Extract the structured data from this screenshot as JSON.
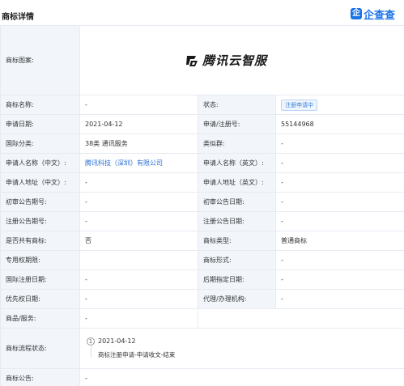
{
  "header": {
    "title": "商标详情",
    "brand_icon": "企",
    "brand_name": "企查查"
  },
  "logo": {
    "label": "商标图案:",
    "text": "腾讯云智服"
  },
  "rows": [
    {
      "l1": "商标名称:",
      "v1": "-",
      "l2": "状态:",
      "v2": "注册申请中"
    },
    {
      "l1": "申请日期:",
      "v1": "2021-04-12",
      "l2": "申请/注册号:",
      "v2": "55144968"
    },
    {
      "l1": "国际分类:",
      "v1": "38类 通讯服务",
      "l2": "类似群:",
      "v2": "-"
    },
    {
      "l1": "申请人名称（中文）:",
      "v1": "腾讯科技（深圳）有限公司",
      "l2": "申请人名称（英文）:",
      "v2": "-"
    },
    {
      "l1": "申请人地址（中文）:",
      "v1": "-",
      "l2": "申请人地址（英文）:",
      "v2": "-"
    },
    {
      "l1": "初审公告期号:",
      "v1": "-",
      "l2": "初审公告日期:",
      "v2": "-"
    },
    {
      "l1": "注册公告期号:",
      "v1": "-",
      "l2": "注册公告日期:",
      "v2": "-"
    },
    {
      "l1": "是否共有商标:",
      "v1": "否",
      "l2": "商标类型:",
      "v2": "普通商标"
    },
    {
      "l1": "专用权期限:",
      "v1": "",
      "l2": "商标形式:",
      "v2": "-"
    },
    {
      "l1": "国际注册日期:",
      "v1": "-",
      "l2": "后期指定日期:",
      "v2": "-"
    },
    {
      "l1": "优先权日期:",
      "v1": "-",
      "l2": "代理/办理机构:",
      "v2": "-"
    }
  ],
  "goods": {
    "label": "商品/服务:",
    "value": "-"
  },
  "flow": {
    "label": "商标流程状态:",
    "step": "1",
    "date": "2021-04-12",
    "desc": "商标注册申请-申请收文-结束"
  },
  "notice": {
    "label": "商标公告:",
    "value": "-"
  },
  "colors": {
    "accent": "#1a73e8",
    "label_bg": "#f2f6fb",
    "border": "#e6ebf2",
    "link": "#2b6fd6"
  }
}
